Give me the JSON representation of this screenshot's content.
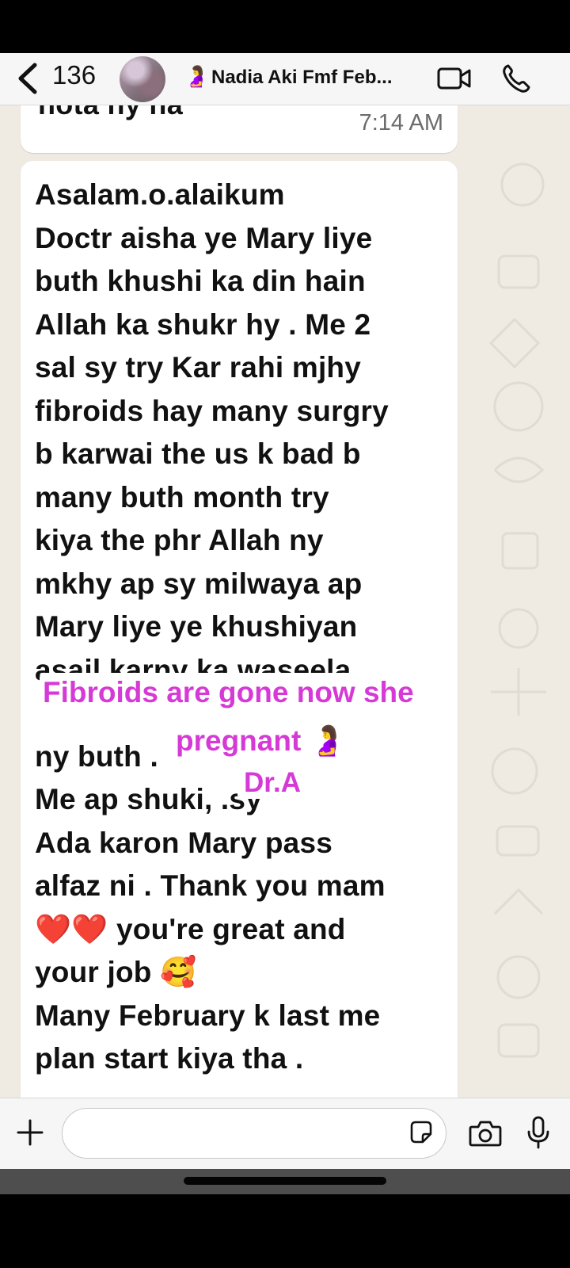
{
  "header": {
    "back_count": "136",
    "contact_emoji": "🤰",
    "contact_name": "Nadia Aki Fmf  Feb..."
  },
  "chat": {
    "previous_message": {
      "text": "nota ny na",
      "time": "7:14 AM"
    },
    "message": {
      "lines": [
        "Asalam.o.alaikum",
        "Doctr aisha ye Mary liye",
        "buth khushi ka din hain",
        "Allah ka shukr hy . Me 2",
        "sal sy try Kar rahi mjhy",
        "fibroids hay many surgry",
        "b karwai the us k bad b",
        "many buth month try",
        "kiya the phr Allah ny",
        "mkhy ap sy milwaya ap",
        "Mary liye ye khushiyan",
        "asail karny ka waseela",
        "",
        "ny buth                           .",
        "Me ap shuki,              .sy",
        "Ada karon Mary pass",
        "alfaz ni . Thank you mam",
        "❤️❤️ you're great and",
        "your job 🥰",
        "Many February k last me",
        "plan start kiya tha ."
      ]
    }
  },
  "overlay": {
    "line1": "Fibroids are gone now she",
    "line2": "pregnant 🤰",
    "line3": "Dr.A",
    "color": "#d63ad6"
  },
  "input": {
    "placeholder": ""
  }
}
